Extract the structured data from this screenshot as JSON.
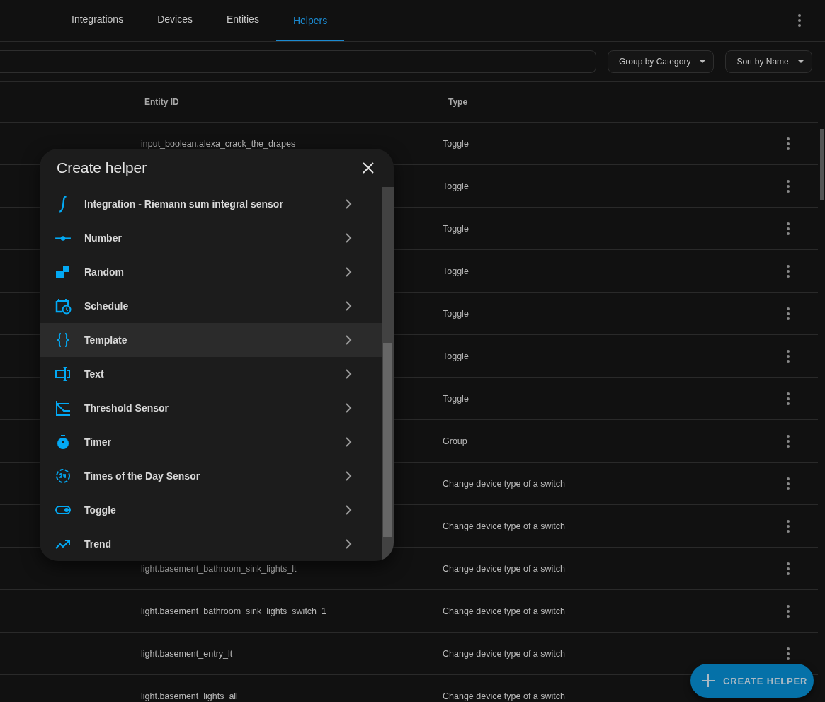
{
  "tabs": [
    {
      "label": "Integrations",
      "selected": false
    },
    {
      "label": "Devices",
      "selected": false
    },
    {
      "label": "Entities",
      "selected": false
    },
    {
      "label": "Helpers",
      "selected": true
    }
  ],
  "toolbar": {
    "group_by": "Group by Category",
    "sort_by": "Sort by Name"
  },
  "table": {
    "columns": [
      "Entity ID",
      "Type"
    ],
    "rows": [
      {
        "entity_id": "input_boolean.alexa_crack_the_drapes",
        "type": "Toggle"
      },
      {
        "type": "Toggle"
      },
      {
        "type": "Toggle"
      },
      {
        "type": "Toggle"
      },
      {
        "type": "Toggle"
      },
      {
        "type": "Toggle"
      },
      {
        "type": "Toggle"
      },
      {
        "type": "Group"
      },
      {
        "type": "Change device type of a switch"
      },
      {
        "type": "Change device type of a switch"
      },
      {
        "entity_id": "light.basement_bathroom_sink_lights_lt",
        "type": "Change device type of a switch"
      },
      {
        "entity_id": "light.basement_bathroom_sink_lights_switch_1",
        "type": "Change device type of a switch"
      },
      {
        "entity_id": "light.basement_entry_lt",
        "type": "Change device type of a switch"
      },
      {
        "entity_id": "light.basement_lights_all",
        "type": "Change device type of a switch"
      }
    ]
  },
  "dialog": {
    "title": "Create helper",
    "items": [
      {
        "label": "Integration - Riemann sum integral sensor",
        "highlighted": false
      },
      {
        "label": "Number",
        "highlighted": false
      },
      {
        "label": "Random",
        "highlighted": false
      },
      {
        "label": "Schedule",
        "highlighted": false
      },
      {
        "label": "Template",
        "highlighted": true
      },
      {
        "label": "Text",
        "highlighted": false
      },
      {
        "label": "Threshold Sensor",
        "highlighted": false
      },
      {
        "label": "Timer",
        "highlighted": false
      },
      {
        "label": "Times of the Day Sensor",
        "highlighted": false
      },
      {
        "label": "Toggle",
        "highlighted": false
      },
      {
        "label": "Trend",
        "highlighted": false
      }
    ]
  },
  "fab": {
    "label": "CREATE HELPER"
  }
}
